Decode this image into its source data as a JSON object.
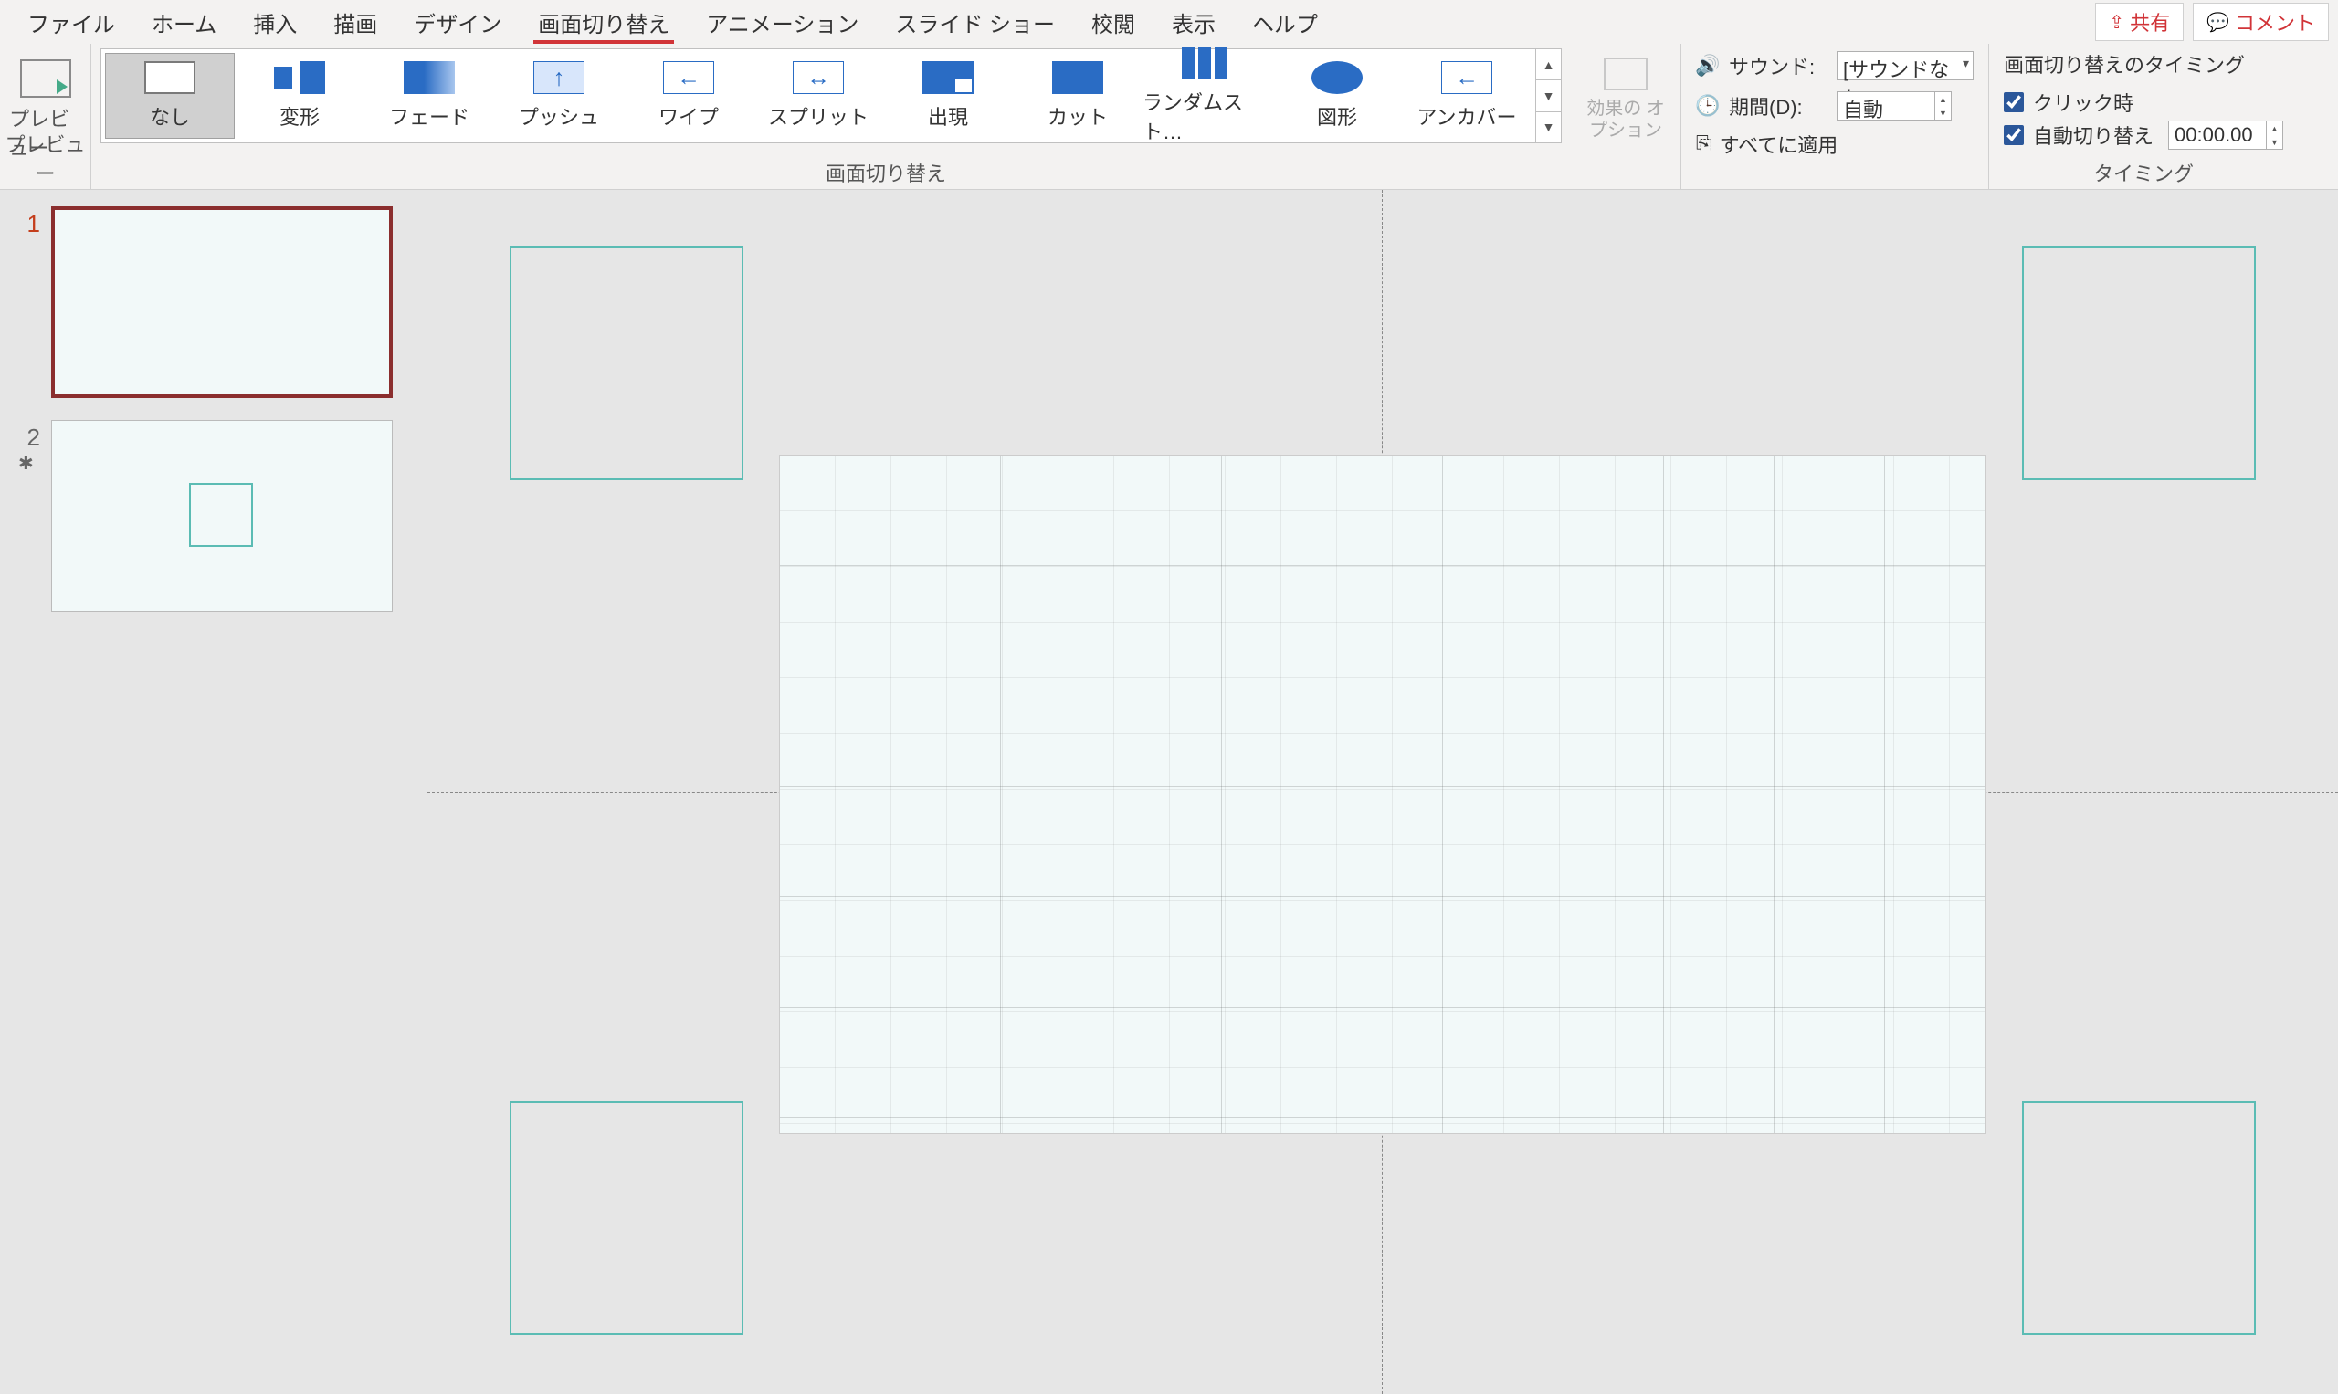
{
  "menu": {
    "tabs": [
      "ファイル",
      "ホーム",
      "挿入",
      "描画",
      "デザイン",
      "画面切り替え",
      "アニメーション",
      "スライド ショー",
      "校閲",
      "表示",
      "ヘルプ"
    ],
    "active_index": 5,
    "share_label": "共有",
    "comment_label": "コメント"
  },
  "ribbon": {
    "preview_group_label": "プレビュー",
    "preview_button_label": "プレビュー",
    "transitions_group_label": "画面切り替え",
    "gallery": [
      {
        "label": "なし",
        "thumb_class": "th-none",
        "selected": true
      },
      {
        "label": "変形",
        "thumb_class": "th-morph"
      },
      {
        "label": "フェード",
        "thumb_class": "th-fade"
      },
      {
        "label": "プッシュ",
        "thumb_class": "th-push"
      },
      {
        "label": "ワイプ",
        "thumb_class": "th-wipe"
      },
      {
        "label": "スプリット",
        "thumb_class": "th-split"
      },
      {
        "label": "出現",
        "thumb_class": "th-reveal"
      },
      {
        "label": "カット",
        "thumb_class": "th-cut"
      },
      {
        "label": "ランダムスト…",
        "thumb_class": "th-random"
      },
      {
        "label": "図形",
        "thumb_class": "th-shape"
      },
      {
        "label": "アンカバー",
        "thumb_class": "th-uncover"
      }
    ],
    "effect_options_label": "効果の\nオプション",
    "sound_label": "サウンド:",
    "sound_value": "[サウンドなし]",
    "duration_label": "期間(D):",
    "duration_value": "自動",
    "apply_all_label": "すべてに適用",
    "timing_group_label": "タイミング",
    "timing_title": "画面切り替えのタイミング",
    "on_click_label": "クリック時",
    "auto_after_label": "自動切り替え",
    "auto_after_value": "00:00.00"
  },
  "slides": [
    {
      "number": "1",
      "selected": true,
      "has_star": false,
      "has_mini": false
    },
    {
      "number": "2",
      "selected": false,
      "has_star": true,
      "has_mini": true
    }
  ]
}
